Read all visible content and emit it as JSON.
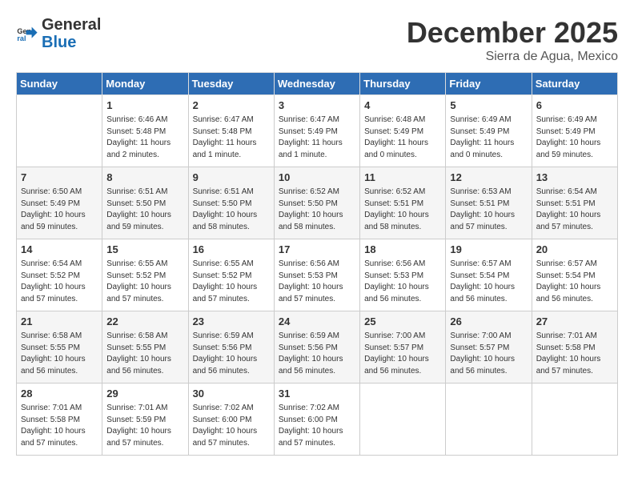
{
  "logo": {
    "line1": "General",
    "line2": "Blue"
  },
  "title": "December 2025",
  "subtitle": "Sierra de Agua, Mexico",
  "days_header": [
    "Sunday",
    "Monday",
    "Tuesday",
    "Wednesday",
    "Thursday",
    "Friday",
    "Saturday"
  ],
  "weeks": [
    [
      {
        "num": "",
        "info": ""
      },
      {
        "num": "1",
        "info": "Sunrise: 6:46 AM\nSunset: 5:48 PM\nDaylight: 11 hours\nand 2 minutes."
      },
      {
        "num": "2",
        "info": "Sunrise: 6:47 AM\nSunset: 5:48 PM\nDaylight: 11 hours\nand 1 minute."
      },
      {
        "num": "3",
        "info": "Sunrise: 6:47 AM\nSunset: 5:49 PM\nDaylight: 11 hours\nand 1 minute."
      },
      {
        "num": "4",
        "info": "Sunrise: 6:48 AM\nSunset: 5:49 PM\nDaylight: 11 hours\nand 0 minutes."
      },
      {
        "num": "5",
        "info": "Sunrise: 6:49 AM\nSunset: 5:49 PM\nDaylight: 11 hours\nand 0 minutes."
      },
      {
        "num": "6",
        "info": "Sunrise: 6:49 AM\nSunset: 5:49 PM\nDaylight: 10 hours\nand 59 minutes."
      }
    ],
    [
      {
        "num": "7",
        "info": "Sunrise: 6:50 AM\nSunset: 5:49 PM\nDaylight: 10 hours\nand 59 minutes."
      },
      {
        "num": "8",
        "info": "Sunrise: 6:51 AM\nSunset: 5:50 PM\nDaylight: 10 hours\nand 59 minutes."
      },
      {
        "num": "9",
        "info": "Sunrise: 6:51 AM\nSunset: 5:50 PM\nDaylight: 10 hours\nand 58 minutes."
      },
      {
        "num": "10",
        "info": "Sunrise: 6:52 AM\nSunset: 5:50 PM\nDaylight: 10 hours\nand 58 minutes."
      },
      {
        "num": "11",
        "info": "Sunrise: 6:52 AM\nSunset: 5:51 PM\nDaylight: 10 hours\nand 58 minutes."
      },
      {
        "num": "12",
        "info": "Sunrise: 6:53 AM\nSunset: 5:51 PM\nDaylight: 10 hours\nand 57 minutes."
      },
      {
        "num": "13",
        "info": "Sunrise: 6:54 AM\nSunset: 5:51 PM\nDaylight: 10 hours\nand 57 minutes."
      }
    ],
    [
      {
        "num": "14",
        "info": "Sunrise: 6:54 AM\nSunset: 5:52 PM\nDaylight: 10 hours\nand 57 minutes."
      },
      {
        "num": "15",
        "info": "Sunrise: 6:55 AM\nSunset: 5:52 PM\nDaylight: 10 hours\nand 57 minutes."
      },
      {
        "num": "16",
        "info": "Sunrise: 6:55 AM\nSunset: 5:52 PM\nDaylight: 10 hours\nand 57 minutes."
      },
      {
        "num": "17",
        "info": "Sunrise: 6:56 AM\nSunset: 5:53 PM\nDaylight: 10 hours\nand 57 minutes."
      },
      {
        "num": "18",
        "info": "Sunrise: 6:56 AM\nSunset: 5:53 PM\nDaylight: 10 hours\nand 56 minutes."
      },
      {
        "num": "19",
        "info": "Sunrise: 6:57 AM\nSunset: 5:54 PM\nDaylight: 10 hours\nand 56 minutes."
      },
      {
        "num": "20",
        "info": "Sunrise: 6:57 AM\nSunset: 5:54 PM\nDaylight: 10 hours\nand 56 minutes."
      }
    ],
    [
      {
        "num": "21",
        "info": "Sunrise: 6:58 AM\nSunset: 5:55 PM\nDaylight: 10 hours\nand 56 minutes."
      },
      {
        "num": "22",
        "info": "Sunrise: 6:58 AM\nSunset: 5:55 PM\nDaylight: 10 hours\nand 56 minutes."
      },
      {
        "num": "23",
        "info": "Sunrise: 6:59 AM\nSunset: 5:56 PM\nDaylight: 10 hours\nand 56 minutes."
      },
      {
        "num": "24",
        "info": "Sunrise: 6:59 AM\nSunset: 5:56 PM\nDaylight: 10 hours\nand 56 minutes."
      },
      {
        "num": "25",
        "info": "Sunrise: 7:00 AM\nSunset: 5:57 PM\nDaylight: 10 hours\nand 56 minutes."
      },
      {
        "num": "26",
        "info": "Sunrise: 7:00 AM\nSunset: 5:57 PM\nDaylight: 10 hours\nand 56 minutes."
      },
      {
        "num": "27",
        "info": "Sunrise: 7:01 AM\nSunset: 5:58 PM\nDaylight: 10 hours\nand 57 minutes."
      }
    ],
    [
      {
        "num": "28",
        "info": "Sunrise: 7:01 AM\nSunset: 5:58 PM\nDaylight: 10 hours\nand 57 minutes."
      },
      {
        "num": "29",
        "info": "Sunrise: 7:01 AM\nSunset: 5:59 PM\nDaylight: 10 hours\nand 57 minutes."
      },
      {
        "num": "30",
        "info": "Sunrise: 7:02 AM\nSunset: 6:00 PM\nDaylight: 10 hours\nand 57 minutes."
      },
      {
        "num": "31",
        "info": "Sunrise: 7:02 AM\nSunset: 6:00 PM\nDaylight: 10 hours\nand 57 minutes."
      },
      {
        "num": "",
        "info": ""
      },
      {
        "num": "",
        "info": ""
      },
      {
        "num": "",
        "info": ""
      }
    ]
  ]
}
